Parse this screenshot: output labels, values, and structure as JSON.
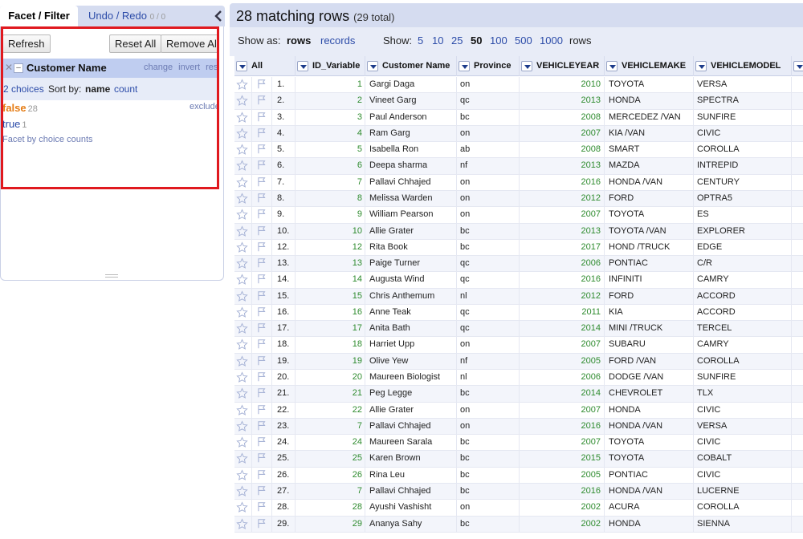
{
  "left": {
    "tabs": {
      "facet": "Facet / Filter",
      "undo": "Undo / Redo",
      "undo_count": "0 / 0"
    },
    "toolbar": {
      "refresh": "Refresh",
      "reset_all": "Reset All",
      "remove_all": "Remove All"
    },
    "facet": {
      "title": "Customer Name",
      "links": [
        "change",
        "invert",
        "reset"
      ],
      "choices_count": "2 choices",
      "sort_by": "Sort by:",
      "sort_name": "name",
      "sort_count": "count",
      "choices": [
        {
          "name": "false",
          "count": "28"
        },
        {
          "name": "true",
          "count": "1"
        }
      ],
      "exclude": "exclude",
      "facet_by_counts": "Facet by choice counts"
    }
  },
  "summary": {
    "main": "28 matching rows",
    "total": "(29 total)"
  },
  "controls": {
    "show_as": "Show as:",
    "rows": "rows",
    "records": "records",
    "show": "Show:",
    "page_sizes": [
      "5",
      "10",
      "25",
      "50",
      "100",
      "500",
      "1000"
    ],
    "active_page_size": "50",
    "rows_label": "rows"
  },
  "columns": [
    "All",
    "ID_Variable",
    "Customer Name",
    "Province",
    "VEHICLEYEAR",
    "VEHICLEMAKE",
    "VEHICLEMODEL"
  ],
  "rows": [
    {
      "n": "1.",
      "id": "1",
      "name": "Gargi Daga",
      "prov": "on",
      "year": "2010",
      "make": "TOYOTA",
      "model": "VERSA"
    },
    {
      "n": "2.",
      "id": "2",
      "name": "Vineet Garg",
      "prov": "qc",
      "year": "2013",
      "make": "HONDA",
      "model": "SPECTRA"
    },
    {
      "n": "3.",
      "id": "3",
      "name": "Paul Anderson",
      "prov": "bc",
      "year": "2008",
      "make": "MERCEDEZ /VAN",
      "model": "SUNFIRE"
    },
    {
      "n": "4.",
      "id": "4",
      "name": "Ram Garg",
      "prov": "on",
      "year": "2007",
      "make": "KIA /VAN",
      "model": "CIVIC"
    },
    {
      "n": "5.",
      "id": "5",
      "name": "Isabella Ron",
      "prov": "ab",
      "year": "2008",
      "make": "SMART",
      "model": "COROLLA"
    },
    {
      "n": "6.",
      "id": "6",
      "name": "Deepa sharma",
      "prov": "nf",
      "year": "2013",
      "make": "MAZDA",
      "model": "INTREPID"
    },
    {
      "n": "7.",
      "id": "7",
      "name": "Pallavi Chhajed",
      "prov": "on",
      "year": "2016",
      "make": "HONDA /VAN",
      "model": "CENTURY"
    },
    {
      "n": "8.",
      "id": "8",
      "name": "Melissa Warden",
      "prov": "on",
      "year": "2012",
      "make": "FORD",
      "model": "OPTRA5"
    },
    {
      "n": "9.",
      "id": "9",
      "name": "William Pearson",
      "prov": "on",
      "year": "2007",
      "make": "TOYOTA",
      "model": "ES"
    },
    {
      "n": "10.",
      "id": "10",
      "name": "Allie Grater",
      "prov": "bc",
      "year": "2013",
      "make": "TOYOTA /VAN",
      "model": "EXPLORER"
    },
    {
      "n": "12.",
      "id": "12",
      "name": "Rita Book",
      "prov": "bc",
      "year": "2017",
      "make": "HOND /TRUCK",
      "model": "EDGE"
    },
    {
      "n": "13.",
      "id": "13",
      "name": "Paige Turner",
      "prov": "qc",
      "year": "2006",
      "make": "PONTIAC",
      "model": "C/R"
    },
    {
      "n": "14.",
      "id": "14",
      "name": "Augusta Wind",
      "prov": "qc",
      "year": "2016",
      "make": "INFINITI",
      "model": "CAMRY"
    },
    {
      "n": "15.",
      "id": "15",
      "name": "Chris Anthemum",
      "prov": "nl",
      "year": "2012",
      "make": "FORD",
      "model": "ACCORD"
    },
    {
      "n": "16.",
      "id": "16",
      "name": "Anne Teak",
      "prov": "qc",
      "year": "2011",
      "make": "KIA",
      "model": "ACCORD"
    },
    {
      "n": "17.",
      "id": "17",
      "name": "Anita Bath",
      "prov": "qc",
      "year": "2014",
      "make": "MINI /TRUCK",
      "model": "TERCEL"
    },
    {
      "n": "18.",
      "id": "18",
      "name": "Harriet Upp",
      "prov": "on",
      "year": "2007",
      "make": "SUBARU",
      "model": "CAMRY"
    },
    {
      "n": "19.",
      "id": "19",
      "name": "Olive Yew",
      "prov": "nf",
      "year": "2005",
      "make": "FORD /VAN",
      "model": "COROLLA"
    },
    {
      "n": "20.",
      "id": "20",
      "name": "Maureen Biologist",
      "prov": "nl",
      "year": "2006",
      "make": "DODGE /VAN",
      "model": "SUNFIRE"
    },
    {
      "n": "21.",
      "id": "21",
      "name": "Peg Legge",
      "prov": "bc",
      "year": "2014",
      "make": "CHEVROLET",
      "model": "TLX"
    },
    {
      "n": "22.",
      "id": "22",
      "name": "Allie Grater",
      "prov": "on",
      "year": "2007",
      "make": "HONDA",
      "model": "CIVIC"
    },
    {
      "n": "23.",
      "id": "7",
      "name": "Pallavi Chhajed",
      "prov": "on",
      "year": "2016",
      "make": "HONDA /VAN",
      "model": "VERSA"
    },
    {
      "n": "24.",
      "id": "24",
      "name": "Maureen Sarala",
      "prov": "bc",
      "year": "2007",
      "make": "TOYOTA",
      "model": "CIVIC"
    },
    {
      "n": "25.",
      "id": "25",
      "name": "Karen Brown",
      "prov": "bc",
      "year": "2015",
      "make": "TOYOTA",
      "model": "COBALT"
    },
    {
      "n": "26.",
      "id": "26",
      "name": "Rina Leu",
      "prov": "bc",
      "year": "2005",
      "make": "PONTIAC",
      "model": "CIVIC"
    },
    {
      "n": "27.",
      "id": "7",
      "name": "Pallavi Chhajed",
      "prov": "bc",
      "year": "2016",
      "make": "HONDA /VAN",
      "model": "LUCERNE"
    },
    {
      "n": "28.",
      "id": "28",
      "name": "Ayushi Vashisht",
      "prov": "on",
      "year": "2002",
      "make": "ACURA",
      "model": "COROLLA"
    },
    {
      "n": "29.",
      "id": "29",
      "name": "Ananya Sahy",
      "prov": "bc",
      "year": "2002",
      "make": "HONDA",
      "model": "SIENNA"
    }
  ]
}
